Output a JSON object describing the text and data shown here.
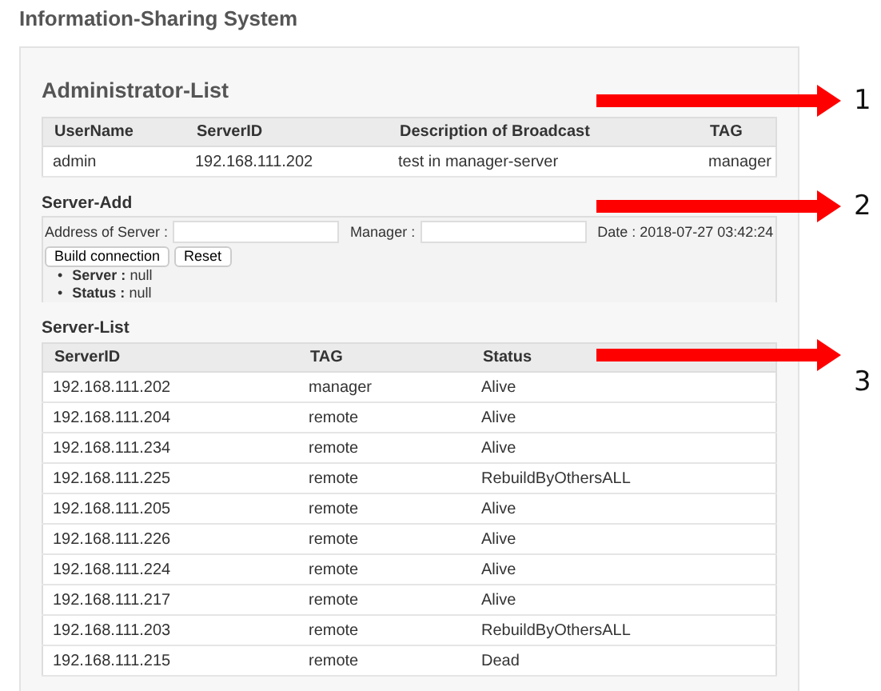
{
  "page_title": "Information-Sharing System",
  "admin_list": {
    "title": "Administrator-List",
    "columns": [
      "UserName",
      "ServerID",
      "Description of Broadcast",
      "TAG"
    ],
    "rows": [
      [
        "admin",
        "192.168.111.202",
        "test in manager-server",
        "manager"
      ]
    ]
  },
  "server_add": {
    "title": "Server-Add",
    "address_label": "Address of Server :",
    "manager_label": "Manager :",
    "date": "Date : 2018-07-27 03:42:24",
    "buttons": [
      "Build connection",
      "Reset"
    ],
    "info": [
      {
        "marker": "•",
        "label": "Server :",
        "value": "null"
      },
      {
        "marker": "•",
        "label": "Status :",
        "value": "null"
      }
    ]
  },
  "server_list": {
    "title": "Server-List",
    "columns": [
      "ServerID",
      "TAG",
      "Status"
    ],
    "rows": [
      [
        "192.168.111.202",
        "manager",
        "Alive"
      ],
      [
        "192.168.111.204",
        "remote",
        "Alive"
      ],
      [
        "192.168.111.234",
        "remote",
        "Alive"
      ],
      [
        "192.168.111.225",
        "remote",
        "RebuildByOthersALL"
      ],
      [
        "192.168.111.205",
        "remote",
        "Alive"
      ],
      [
        "192.168.111.226",
        "remote",
        "Alive"
      ],
      [
        "192.168.111.224",
        "remote",
        "Alive"
      ],
      [
        "192.168.111.217",
        "remote",
        "Alive"
      ],
      [
        "192.168.111.203",
        "remote",
        "RebuildByOthersALL"
      ],
      [
        "192.168.111.215",
        "remote",
        "Dead"
      ]
    ]
  },
  "annotations": [
    "1",
    "2",
    "3"
  ]
}
